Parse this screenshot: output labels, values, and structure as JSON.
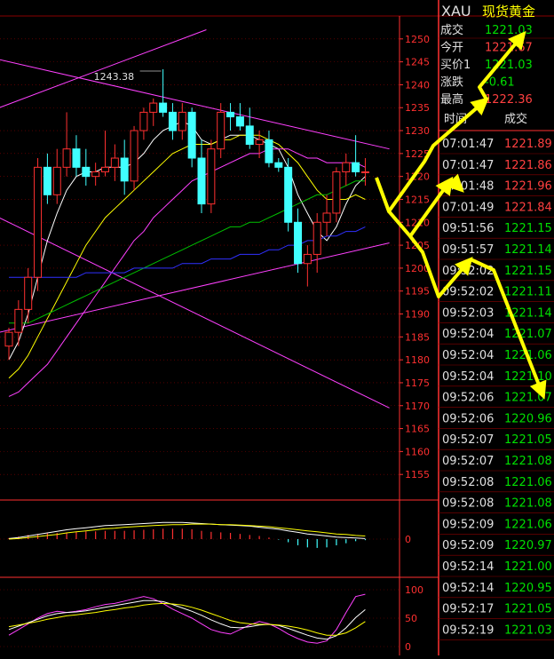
{
  "quote_panel": {
    "symbol": "XAU",
    "name": "现货黄金",
    "rows": [
      {
        "label": "成交",
        "value": "1221.03",
        "color": "#00e000"
      },
      {
        "label": "今开",
        "value": "1221.67",
        "color": "#ff4040"
      },
      {
        "label": "买价1",
        "value": "1221.03",
        "color": "#00e000"
      },
      {
        "label": "涨跌",
        "value": "-0.61",
        "color": "#00e000"
      },
      {
        "label": "最高",
        "value": "1222.36",
        "color": "#ff4040"
      }
    ],
    "ticks_header": {
      "time": "时间",
      "price": "成交"
    },
    "ticks": [
      {
        "time": "07:01:47",
        "price": "1221.89",
        "color": "#ff4040"
      },
      {
        "time": "07:01:47",
        "price": "1221.86",
        "color": "#ff4040"
      },
      {
        "time": "07:01:48",
        "price": "1221.96",
        "color": "#ff4040"
      },
      {
        "time": "07:01:49",
        "price": "1221.84",
        "color": "#ff4040"
      },
      {
        "time": "09:51:56",
        "price": "1221.15",
        "color": "#00e000"
      },
      {
        "time": "09:51:57",
        "price": "1221.14",
        "color": "#00e000"
      },
      {
        "time": "09:52:02",
        "price": "1221.15",
        "color": "#00e000"
      },
      {
        "time": "09:52:02",
        "price": "1221.11",
        "color": "#00e000"
      },
      {
        "time": "09:52:03",
        "price": "1221.14",
        "color": "#00e000"
      },
      {
        "time": "09:52:04",
        "price": "1221.07",
        "color": "#00e000"
      },
      {
        "time": "09:52:04",
        "price": "1221.06",
        "color": "#00e000"
      },
      {
        "time": "09:52:04",
        "price": "1221.10",
        "color": "#00e000"
      },
      {
        "time": "09:52:06",
        "price": "1221.07",
        "color": "#00e000"
      },
      {
        "time": "09:52:06",
        "price": "1220.96",
        "color": "#00e000"
      },
      {
        "time": "09:52:07",
        "price": "1221.05",
        "color": "#00e000"
      },
      {
        "time": "09:52:07",
        "price": "1221.08",
        "color": "#00e000"
      },
      {
        "time": "09:52:08",
        "price": "1221.06",
        "color": "#00e000"
      },
      {
        "time": "09:52:08",
        "price": "1221.08",
        "color": "#00e000"
      },
      {
        "time": "09:52:09",
        "price": "1221.06",
        "color": "#00e000"
      },
      {
        "time": "09:52:09",
        "price": "1220.97",
        "color": "#00e000"
      },
      {
        "time": "09:52:14",
        "price": "1221.00",
        "color": "#00e000"
      },
      {
        "time": "09:52:14",
        "price": "1220.95",
        "color": "#00e000"
      },
      {
        "time": "09:52:17",
        "price": "1221.05",
        "color": "#00e000"
      },
      {
        "time": "09:52:19",
        "price": "1221.03",
        "color": "#00e000"
      }
    ]
  },
  "chart_data": [
    {
      "type": "candlestick",
      "title": "",
      "high_label": "1243.38",
      "ylim": [
        1150,
        1255
      ],
      "y_ticks": [
        1155,
        1160,
        1165,
        1170,
        1175,
        1180,
        1185,
        1190,
        1195,
        1200,
        1205,
        1210,
        1215,
        1220,
        1225,
        1230,
        1235,
        1240,
        1245,
        1250
      ],
      "candles": [
        {
          "o": 1183,
          "h": 1187,
          "l": 1180,
          "c": 1186
        },
        {
          "o": 1186,
          "h": 1193,
          "l": 1183,
          "c": 1191
        },
        {
          "o": 1191,
          "h": 1200,
          "l": 1188,
          "c": 1198
        },
        {
          "o": 1198,
          "h": 1224,
          "l": 1195,
          "c": 1222
        },
        {
          "o": 1222,
          "h": 1225,
          "l": 1214,
          "c": 1216
        },
        {
          "o": 1216,
          "h": 1226,
          "l": 1214,
          "c": 1222
        },
        {
          "o": 1222,
          "h": 1234,
          "l": 1220,
          "c": 1226
        },
        {
          "o": 1226,
          "h": 1229,
          "l": 1220,
          "c": 1222
        },
        {
          "o": 1222,
          "h": 1226,
          "l": 1218,
          "c": 1220
        },
        {
          "o": 1220,
          "h": 1223,
          "l": 1218,
          "c": 1221
        },
        {
          "o": 1221,
          "h": 1230,
          "l": 1220,
          "c": 1222
        },
        {
          "o": 1222,
          "h": 1227,
          "l": 1219,
          "c": 1224
        },
        {
          "o": 1224,
          "h": 1228,
          "l": 1216,
          "c": 1219
        },
        {
          "o": 1219,
          "h": 1231,
          "l": 1217,
          "c": 1230
        },
        {
          "o": 1230,
          "h": 1235,
          "l": 1228,
          "c": 1234
        },
        {
          "o": 1234,
          "h": 1237,
          "l": 1231,
          "c": 1236
        },
        {
          "o": 1236,
          "h": 1243.38,
          "l": 1233,
          "c": 1234
        },
        {
          "o": 1234,
          "h": 1236,
          "l": 1228,
          "c": 1230
        },
        {
          "o": 1230,
          "h": 1236,
          "l": 1228,
          "c": 1234
        },
        {
          "o": 1234,
          "h": 1235,
          "l": 1222,
          "c": 1224
        },
        {
          "o": 1224,
          "h": 1228,
          "l": 1212,
          "c": 1214
        },
        {
          "o": 1214,
          "h": 1228,
          "l": 1212,
          "c": 1226
        },
        {
          "o": 1226,
          "h": 1236,
          "l": 1224,
          "c": 1234
        },
        {
          "o": 1234,
          "h": 1236,
          "l": 1230,
          "c": 1233
        },
        {
          "o": 1233,
          "h": 1236,
          "l": 1230,
          "c": 1231
        },
        {
          "o": 1231,
          "h": 1235,
          "l": 1226,
          "c": 1227
        },
        {
          "o": 1227,
          "h": 1230,
          "l": 1224,
          "c": 1228
        },
        {
          "o": 1228,
          "h": 1230,
          "l": 1222,
          "c": 1223
        },
        {
          "o": 1223,
          "h": 1224,
          "l": 1221,
          "c": 1222
        },
        {
          "o": 1222,
          "h": 1224,
          "l": 1208,
          "c": 1210
        },
        {
          "o": 1210,
          "h": 1213,
          "l": 1199,
          "c": 1201
        },
        {
          "o": 1201,
          "h": 1205,
          "l": 1196,
          "c": 1203
        },
        {
          "o": 1203,
          "h": 1212,
          "l": 1199,
          "c": 1210
        },
        {
          "o": 1210,
          "h": 1216,
          "l": 1207,
          "c": 1212
        },
        {
          "o": 1212,
          "h": 1222,
          "l": 1210,
          "c": 1221
        },
        {
          "o": 1221,
          "h": 1225,
          "l": 1218,
          "c": 1223
        },
        {
          "o": 1223,
          "h": 1229,
          "l": 1220,
          "c": 1221
        },
        {
          "o": 1221,
          "h": 1224,
          "l": 1218,
          "c": 1221
        }
      ],
      "ma_series": [
        {
          "color": "#ffffff",
          "values": [
            1180,
            1184,
            1190,
            1198,
            1206,
            1212,
            1217,
            1220,
            1221,
            1221,
            1222,
            1222,
            1222,
            1223,
            1225,
            1228,
            1230,
            1231,
            1232,
            1231,
            1228,
            1227,
            1228,
            1229,
            1229,
            1229,
            1228,
            1227,
            1226,
            1222,
            1216,
            1212,
            1208,
            1206,
            1209,
            1214,
            1218,
            1220
          ]
        },
        {
          "color": "#ffff00",
          "values": [
            1176,
            1178,
            1181,
            1185,
            1189,
            1193,
            1197,
            1201,
            1205,
            1208,
            1211,
            1213,
            1215,
            1217,
            1219,
            1221,
            1223,
            1225,
            1226,
            1227,
            1227,
            1227,
            1228,
            1228,
            1229,
            1229,
            1229,
            1228,
            1227,
            1225,
            1223,
            1220,
            1217,
            1215,
            1215,
            1215,
            1216,
            1215
          ]
        },
        {
          "color": "#ff40ff",
          "values": [
            1172,
            1173,
            1175,
            1177,
            1179,
            1182,
            1185,
            1188,
            1191,
            1194,
            1197,
            1200,
            1203,
            1206,
            1208,
            1211,
            1213,
            1215,
            1217,
            1219,
            1220,
            1221,
            1222,
            1223,
            1224,
            1225,
            1225,
            1226,
            1226,
            1226,
            1225,
            1224,
            1224,
            1223,
            1223,
            1223,
            1223,
            1222
          ]
        },
        {
          "color": "#00c000",
          "values": [
            1188,
            1188,
            1188,
            1189,
            1190,
            1191,
            1192,
            1193,
            1194,
            1195,
            1196,
            1197,
            1198,
            1199,
            1200,
            1201,
            1202,
            1203,
            1204,
            1205,
            1206,
            1207,
            1208,
            1209,
            1209,
            1210,
            1210,
            1211,
            1212,
            1213,
            1214,
            1215,
            1216,
            1216,
            1217,
            1218,
            1219,
            1219
          ]
        },
        {
          "color": "#3030ff",
          "values": [
            1198,
            1198,
            1198,
            1198,
            1198,
            1198,
            1198,
            1198,
            1199,
            1199,
            1199,
            1199,
            1199,
            1200,
            1200,
            1200,
            1200,
            1200,
            1201,
            1201,
            1201,
            1202,
            1202,
            1202,
            1203,
            1203,
            1203,
            1204,
            1204,
            1205,
            1205,
            1206,
            1206,
            1207,
            1207,
            1208,
            1208,
            1209
          ]
        }
      ],
      "trend_lines": [
        {
          "color": "#ff40ff",
          "from": [
            -1,
            1235
          ],
          "to": [
            20.5,
            1252
          ]
        },
        {
          "color": "#ff40ff",
          "from": [
            -1,
            1245.5
          ],
          "to": [
            39.5,
            1226
          ]
        },
        {
          "color": "#ff40ff",
          "from": [
            -1,
            1211
          ],
          "to": [
            39.5,
            1169.5
          ]
        },
        {
          "color": "#ff40ff",
          "from": [
            -1,
            1186
          ],
          "to": [
            39.5,
            1205.5
          ]
        }
      ]
    },
    {
      "type": "bar",
      "title": "",
      "ylim": [
        -6,
        6
      ],
      "y_ticks": [
        0
      ],
      "values": [
        0.2,
        0.5,
        0.8,
        1.0,
        1.1,
        1.2,
        1.3,
        1.4,
        1.5,
        1.5,
        1.6,
        1.6,
        1.6,
        1.7,
        1.8,
        1.9,
        2.0,
        2.0,
        2.0,
        1.9,
        1.6,
        1.4,
        1.3,
        1.2,
        1.0,
        0.8,
        0.6,
        0.3,
        -0.1,
        -0.6,
        -1.2,
        -1.6,
        -1.7,
        -1.6,
        -1.2,
        -0.8,
        -0.4,
        -0.2
      ],
      "lines": [
        {
          "color": "#ffffff",
          "values": [
            0.1,
            0.3,
            0.6,
            0.9,
            1.2,
            1.5,
            1.8,
            2.0,
            2.2,
            2.4,
            2.6,
            2.7,
            2.8,
            2.9,
            3.0,
            3.1,
            3.2,
            3.2,
            3.2,
            3.1,
            3.0,
            2.9,
            2.8,
            2.7,
            2.6,
            2.5,
            2.3,
            2.1,
            1.9,
            1.6,
            1.3,
            1.0,
            0.8,
            0.6,
            0.4,
            0.3,
            0.2,
            0.1
          ]
        },
        {
          "color": "#ffff00",
          "values": [
            0.0,
            0.1,
            0.3,
            0.5,
            0.7,
            0.9,
            1.2,
            1.4,
            1.6,
            1.8,
            2.0,
            2.1,
            2.3,
            2.4,
            2.5,
            2.6,
            2.7,
            2.8,
            2.8,
            2.9,
            2.9,
            2.9,
            2.8,
            2.8,
            2.7,
            2.6,
            2.5,
            2.4,
            2.2,
            2.0,
            1.8,
            1.6,
            1.4,
            1.2,
            1.0,
            0.9,
            0.7,
            0.6
          ]
        }
      ]
    },
    {
      "type": "line",
      "title": "",
      "ylim": [
        0,
        100
      ],
      "y_ticks": [
        0,
        50,
        100
      ],
      "series": [
        {
          "color": "#ff40ff",
          "values": [
            20,
            30,
            40,
            50,
            58,
            62,
            60,
            62,
            65,
            70,
            74,
            76,
            80,
            84,
            88,
            84,
            76,
            66,
            58,
            50,
            40,
            30,
            25,
            22,
            30,
            38,
            44,
            40,
            32,
            22,
            14,
            8,
            6,
            10,
            30,
            60,
            88,
            92
          ]
        },
        {
          "color": "#ffffff",
          "values": [
            30,
            36,
            42,
            48,
            54,
            58,
            60,
            61,
            63,
            66,
            69,
            72,
            75,
            78,
            81,
            81,
            79,
            74,
            68,
            62,
            55,
            47,
            40,
            34,
            33,
            35,
            38,
            39,
            37,
            32,
            26,
            20,
            15,
            13,
            19,
            33,
            51,
            65
          ]
        },
        {
          "color": "#ffff00",
          "values": [
            35,
            38,
            41,
            44,
            48,
            51,
            54,
            56,
            58,
            60,
            63,
            65,
            68,
            70,
            73,
            75,
            76,
            75,
            73,
            69,
            64,
            58,
            52,
            46,
            42,
            40,
            39,
            39,
            38,
            36,
            33,
            29,
            24,
            20,
            20,
            24,
            33,
            44
          ]
        }
      ]
    }
  ],
  "annotation_arrows_color": "#ffff00"
}
